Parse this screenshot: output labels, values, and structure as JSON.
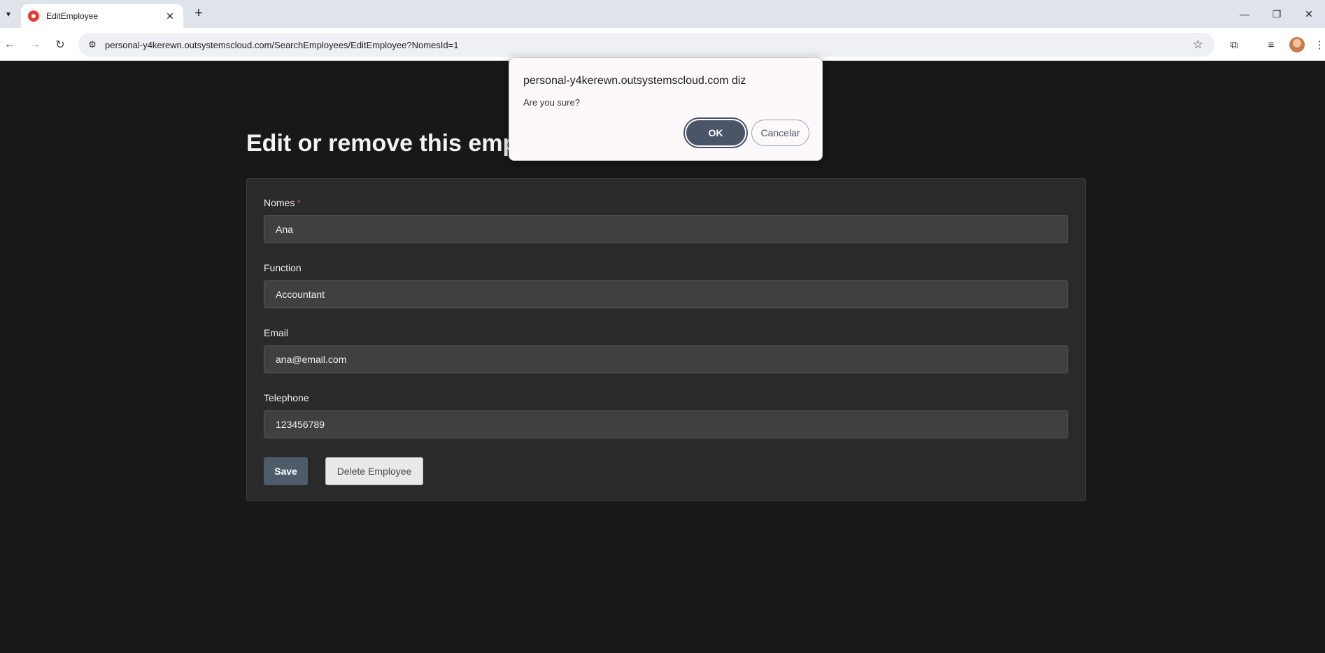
{
  "browser": {
    "tab_title": "EditEmployee",
    "url": "personal-y4kerewn.outsystemscloud.com/SearchEmployees/EditEmployee?NomesId=1",
    "icons": {
      "tab_list": "chevron-down-icon",
      "new_tab": "plus-icon",
      "back": "arrow-left-icon",
      "forward": "arrow-right-icon",
      "reload": "reload-icon",
      "site_info": "tune-icon",
      "bookmark": "star-icon",
      "extensions": "puzzle-icon",
      "media": "playlist-icon",
      "menu": "kebab-icon"
    }
  },
  "page": {
    "title": "Edit or remove this emplo",
    "fields": [
      {
        "label": "Nomes",
        "required": true,
        "value": "Ana"
      },
      {
        "label": "Function",
        "required": false,
        "value": "Accountant"
      },
      {
        "label": "Email",
        "required": false,
        "value": "ana@email.com"
      },
      {
        "label": "Telephone",
        "required": false,
        "value": "123456789"
      }
    ],
    "required_marker": "*",
    "save_label": "Save",
    "delete_label": "Delete Employee"
  },
  "dialog": {
    "title": "personal-y4kerewn.outsystemscloud.com diz",
    "message": "Are you sure?",
    "ok_label": "OK",
    "cancel_label": "Cancelar"
  },
  "colors": {
    "page_bg": "#181818",
    "card_bg": "#2a2a2a",
    "input_bg": "#404040",
    "save_button": "#4d5b6a",
    "required_marker": "#e0443c",
    "dialog_ok": "#4a5568"
  }
}
